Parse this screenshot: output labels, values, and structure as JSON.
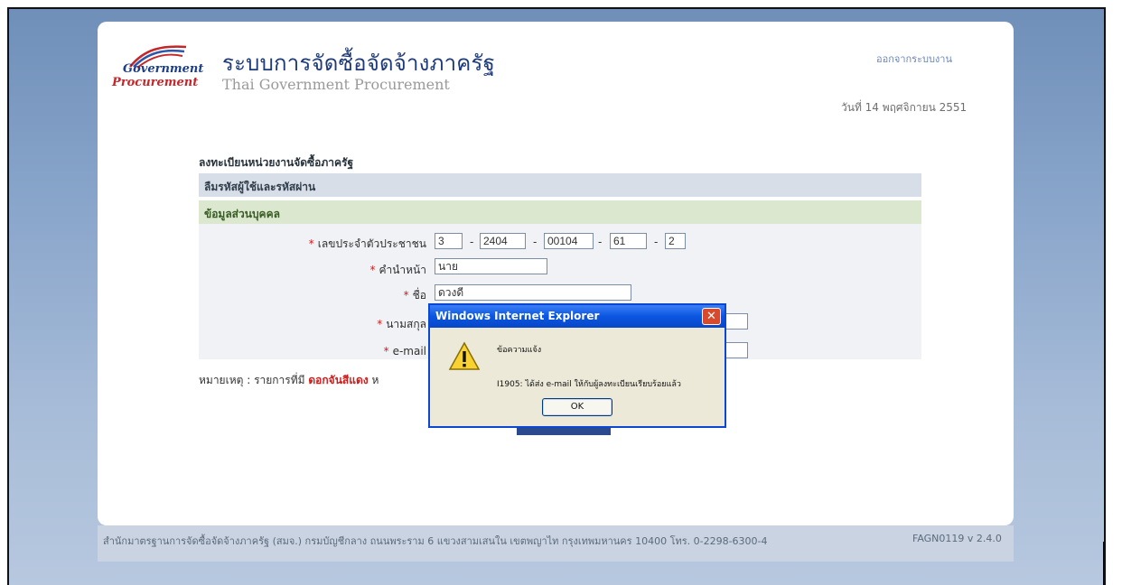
{
  "header": {
    "logo_line1": "Government",
    "logo_line2": "Procurement",
    "title_th": "ระบบการจัดซื้อจัดจ้างภาครัฐ",
    "title_en": "Thai Government Procurement",
    "logout": "ออกจากระบบงาน",
    "date": "วันที่ 14 พฤศจิกายน 2551"
  },
  "form": {
    "section_title": "ลงทะเบียนหน่วยงานจัดซื้อภาครัฐ",
    "band_title": "ลืมรหัสผู้ใช้และรหัสผ่าน",
    "personal_header": "ข้อมูลส่วนบุคคล",
    "required_mark": "*",
    "separator": "-",
    "id_label": "เลขประจำตัวประชาชน",
    "id_parts": [
      "3",
      "2404",
      "00104",
      "61",
      "2"
    ],
    "prefix_label": "คำนำหน้า",
    "prefix_value": "นาย",
    "name_label": "ชื่อ",
    "name_value": "ดวงดี",
    "surname_label": "นามสกุล",
    "surname_value": "",
    "email_label": "e-mail",
    "email_value": "",
    "note_prefix": "หมายเหตุ : รายการที่มี",
    "note_red": "ดอกจันสีแดง",
    "note_suffix": "ห"
  },
  "dialog": {
    "title": "Windows Internet Explorer",
    "close": "✕",
    "heading": "ข้อความแจ้ง",
    "message": "I1905: ได้ส่ง e-mail ให้กับผู้ลงทะเบียนเรียบร้อยแล้ว",
    "ok": "OK"
  },
  "footer": {
    "text": "สำนักมาตรฐานการจัดซื้อจัดจ้างภาครัฐ (สมจ.) กรมบัญชีกลาง ถนนพระราม 6 แขวงสามเสนใน เขตพญาไท กรุงเทพมหานคร 10400 โทร. 0-2298-6300-4",
    "version": "FAGN0119 v 2.4.0"
  },
  "colors": {
    "background": "#8aa6cb",
    "title_blue": "#1f3b7a",
    "required_red": "#d01b1b",
    "dialog_titlebar": "#0a56e0",
    "personal_band": "#dbe8cf"
  }
}
